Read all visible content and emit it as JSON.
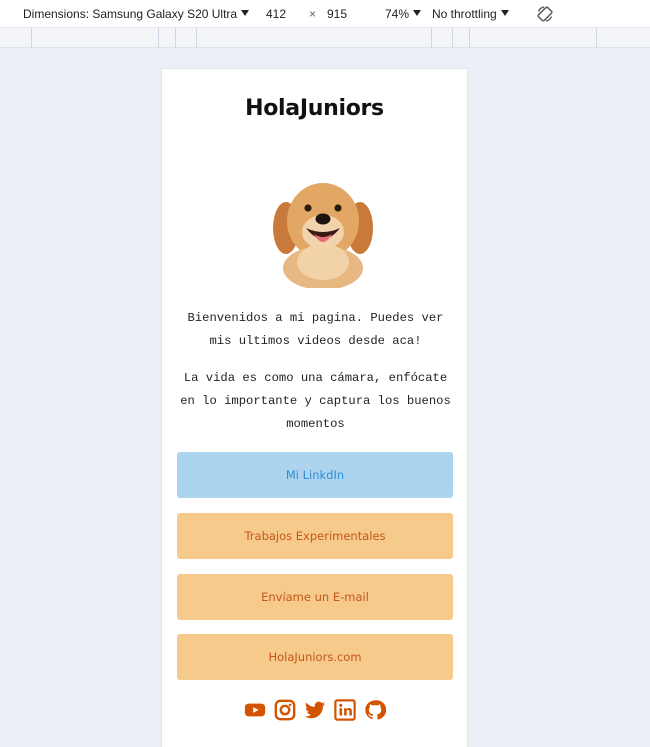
{
  "devtools": {
    "dimensions_label": "Dimensions: Samsung Galaxy S20 Ultra",
    "width": "412",
    "times": "×",
    "height": "915",
    "zoom": "74%",
    "throttling": "No throttling",
    "icons": [
      "rotate-icon"
    ]
  },
  "site": {
    "title": "HolaJuniors",
    "intro": "Bienvenidos a mi pagina. Puedes ver mis ultimos videos desde aca!",
    "quote": "La vida es como una cámara, enfócate en lo importante y captura los buenos momentos",
    "buttons": [
      {
        "label": "Mi LinkdIn",
        "color": "#acd4ee",
        "text_color": "#2e8dd4"
      },
      {
        "label": "Trabajos Experimentales",
        "color": "#f5ca8b",
        "text_color": "#c4571a"
      },
      {
        "label": "Envíame un E-mail",
        "color": "#f5ca8b",
        "text_color": "#c4571a"
      },
      {
        "label": "HolaJuniors.com",
        "color": "#f5ca8b",
        "text_color": "#c4571a"
      }
    ],
    "social_icons": [
      "youtube-icon",
      "instagram-icon",
      "twitter-icon",
      "linkedin-icon",
      "github-icon"
    ],
    "social_color": "#d35400",
    "avatar": "golden-retriever-dog-image"
  }
}
